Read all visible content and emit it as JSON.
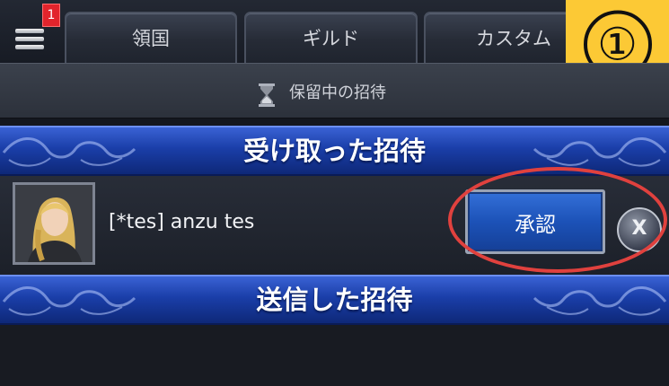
{
  "topbar": {
    "notification_count": "1",
    "tabs": [
      {
        "label": "領国"
      },
      {
        "label": "ギルド"
      },
      {
        "label": "カスタム"
      }
    ]
  },
  "step_badge": "①",
  "pending": {
    "icon": "hourglass-icon",
    "label": "保留中の招待"
  },
  "sections": {
    "received_title": "受け取った招待",
    "sent_title": "送信した招待"
  },
  "invites": [
    {
      "player_name": "[*tes] anzu tes",
      "accept_label": "承認",
      "decline_label": "X"
    }
  ],
  "colors": {
    "banner_blue": "#1a3ea8",
    "accept_blue": "#1c52b8",
    "badge_red": "#e2242c",
    "highlight_red": "#e0413e",
    "step_yellow": "#fcc935"
  }
}
